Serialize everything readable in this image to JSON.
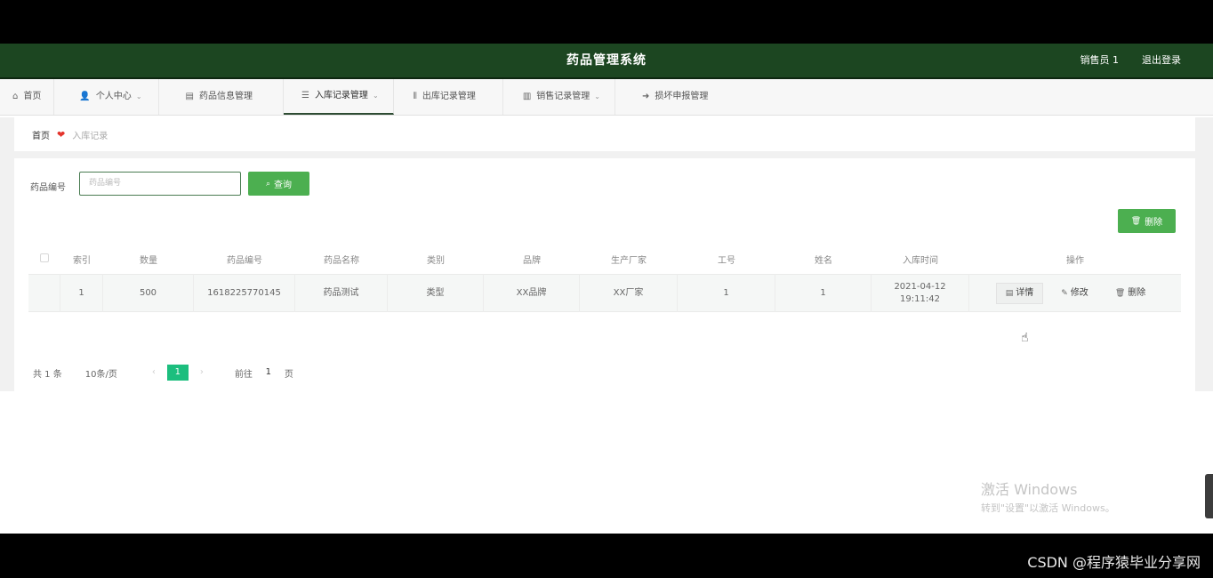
{
  "header": {
    "title": "药品管理系统",
    "user": "销售员 1",
    "logout": "退出登录"
  },
  "nav": [
    {
      "icon": "⌂",
      "label": "首页",
      "chevron": false,
      "active": false
    },
    {
      "icon": "👤",
      "label": "个人中心",
      "chevron": true,
      "active": false
    },
    {
      "icon": "▤",
      "label": "药品信息管理",
      "chevron": false,
      "active": false
    },
    {
      "icon": "☰",
      "label": "入库记录管理",
      "chevron": true,
      "active": true
    },
    {
      "icon": "⫴",
      "label": "出库记录管理",
      "chevron": false,
      "active": false
    },
    {
      "icon": "▥",
      "label": "销售记录管理",
      "chevron": true,
      "active": false
    },
    {
      "icon": "➜",
      "label": "损坏申报管理",
      "chevron": false,
      "active": false
    }
  ],
  "breadcrumb": {
    "home": "首页",
    "current": "入库记录"
  },
  "search": {
    "label": "药品编号",
    "placeholder": "药品编号",
    "button": "查询"
  },
  "actions": {
    "delete": "删除"
  },
  "table": {
    "headers": {
      "idx": "索引",
      "qty": "数量",
      "code": "药品编号",
      "name": "药品名称",
      "category": "类别",
      "brand": "品牌",
      "manufacturer": "生产厂家",
      "emp_no": "工号",
      "emp_name": "姓名",
      "time": "入库时间",
      "ops": "操作"
    },
    "rows": [
      {
        "idx": "1",
        "qty": "500",
        "code": "1618225770145",
        "name": "药品测试",
        "category": "类型",
        "brand": "XX品牌",
        "manufacturer": "XX厂家",
        "emp_no": "1",
        "emp_name": "1",
        "time": "2021-04-12 19:11:42",
        "ops": {
          "detail": "详情",
          "edit": "修改",
          "delete": "删除"
        }
      }
    ]
  },
  "pagination": {
    "total": "共 1 条",
    "page_size": "10条/页",
    "current_page": "1",
    "goto_label": "前往",
    "goto_value": "1",
    "page_unit": "页"
  },
  "watermark": {
    "line1": "激活 Windows",
    "line2": "转到\"设置\"以激活 Windows。"
  },
  "corner_text": "CSDN @程序猿毕业分享网"
}
